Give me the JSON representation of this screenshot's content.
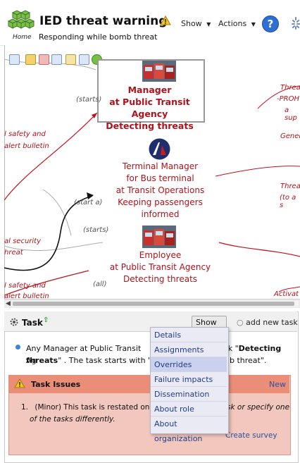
{
  "header": {
    "title": "IED threat warning",
    "subtitle": "Responding while bomb threat",
    "home_label": "Home",
    "show_label": "Show",
    "actions_label": "Actions",
    "help_label": "?"
  },
  "canvas": {
    "toolbar_icons": [
      "layout-icon",
      "export-icon",
      "remove-icon",
      "zoom-icon",
      "fit-icon",
      "panel-icon",
      "help-green-icon"
    ],
    "nodes": [
      {
        "role": "Manager",
        "org": "at Public Transit Agency",
        "task": "Detecting threats"
      },
      {
        "role": "Terminal Manager",
        "place": "for Bus terminal",
        "org": "at Transit Operations",
        "task": "Keeping passengers informed"
      },
      {
        "role": "Employee",
        "org": "at Public Transit Agency",
        "task": "Detecting threats"
      }
    ],
    "edge_labels": {
      "starts_1": "(starts)",
      "start_a": "(start a)",
      "starts_2": "(starts)",
      "all": "(all)"
    },
    "left_texts": [
      "l safety and",
      "alert bulletin",
      "al security",
      "hreat",
      "l safety and",
      "alert bulletin"
    ],
    "right_texts": [
      "Threa",
      "-PROH",
      "a sup",
      "Gener",
      "Threa",
      "(to a s",
      "Activat"
    ]
  },
  "panel": {
    "task_label": "Task",
    "show_label": "Show",
    "add_task_label": "add new task",
    "description_prefix": "Any Manager at Public Transit Ag",
    "description_mid": "sk \"",
    "description_bold": "Detecting threats",
    "description_suffix": "\" . The task starts with \"res",
    "description_end": "b threat\".",
    "issues": {
      "title": "Task Issues",
      "new_label": "New",
      "issue_number": "1.",
      "issue_text": "(Minor) This task is restated once.",
      "issue_text_tail": "sk or specify one",
      "issue_text_line2": "of the tasks differently.",
      "create_survey": "Create survey"
    }
  },
  "menu": {
    "items": [
      "Details",
      "Assignments",
      "Overrides",
      "Failure impacts",
      "Dissemination",
      "About role",
      "About organization"
    ],
    "highlighted": "Overrides"
  },
  "colors": {
    "accent_red": "#b0121b",
    "link_blue": "#2d4fa0",
    "issue_header": "#ea8e78",
    "issue_body": "#f2c7bd"
  }
}
